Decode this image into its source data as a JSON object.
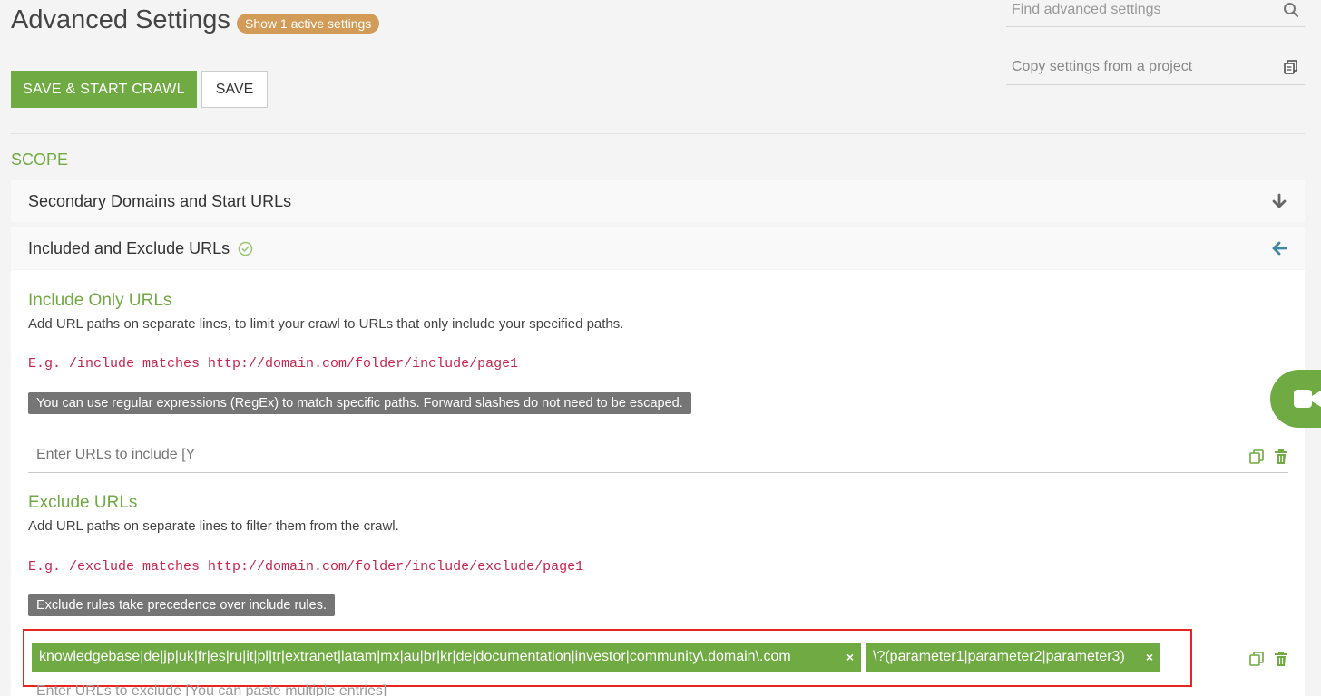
{
  "header": {
    "title": "Advanced Settings",
    "active_badge": "Show 1 active settings",
    "search_placeholder": "Find advanced settings",
    "copy_placeholder": "Copy settings from a project"
  },
  "toolbar": {
    "save_start_label": "SAVE & START CRAWL",
    "save_label": "SAVE"
  },
  "scope": {
    "section_label": "SCOPE",
    "panels": [
      {
        "label": "Secondary Domains and Start URLs",
        "state": "collapsed"
      },
      {
        "label": "Included and Exclude URLs",
        "state": "expanded"
      }
    ]
  },
  "include": {
    "title": "Include Only URLs",
    "description": "Add URL paths on separate lines, to limit your crawl to URLs that only include your specified paths.",
    "example": "E.g. /include matches http://domain.com/folder/include/page1",
    "note": "You can use regular expressions (RegEx) to match specific paths. Forward slashes do not need to be escaped.",
    "input_placeholder": "Enter URLs to include [Y"
  },
  "exclude": {
    "title": "Exclude URLs",
    "description": "Add URL paths on separate lines to filter them from the crawl.",
    "example": "E.g. /exclude matches http://domain.com/folder/include/exclude/page1",
    "note": "Exclude rules take precedence over include rules.",
    "tags": [
      "knowledgebase|de|jp|uk|fr|es|ru|it|pl|tr|extranet|latam|mx|au|br|kr|de|documentation|investor|community\\.domain\\.com",
      "\\?(parameter1|parameter2|parameter3)"
    ],
    "tag_remove": "×",
    "input_placeholder": "Enter URLs to exclude [You can paste multiple entries]"
  },
  "colors": {
    "accent": "#70aa43",
    "badge": "#d29b57",
    "highlight": "#e8261d"
  },
  "icons": {
    "search": "search-icon",
    "copy": "clipboard-icon",
    "arrow_down": "arrow-down-icon",
    "arrow_left": "arrow-left-icon",
    "check": "check-circle-icon",
    "trash": "trash-icon",
    "video": "video-icon"
  }
}
